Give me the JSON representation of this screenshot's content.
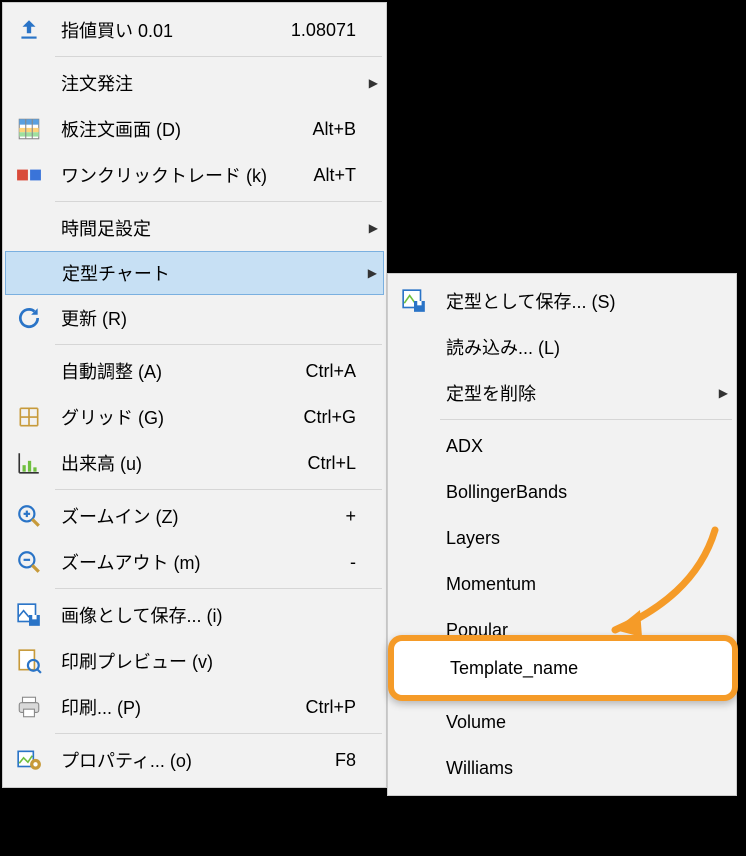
{
  "main_menu": {
    "limit_buy": {
      "label": "指値買い 0.01",
      "value": "1.08071"
    },
    "order": {
      "label": "注文発注"
    },
    "book": {
      "label": "板注文画面 (D)",
      "shortcut": "Alt+B"
    },
    "oneclick": {
      "label": "ワンクリックトレード (k)",
      "shortcut": "Alt+T"
    },
    "timeframe": {
      "label": "時間足設定"
    },
    "template": {
      "label": "定型チャート"
    },
    "refresh": {
      "label": "更新 (R)"
    },
    "autoscale": {
      "label": "自動調整 (A)",
      "shortcut": "Ctrl+A"
    },
    "grid": {
      "label": "グリッド (G)",
      "shortcut": "Ctrl+G"
    },
    "volume": {
      "label": "出来高 (u)",
      "shortcut": "Ctrl+L"
    },
    "zoomin": {
      "label": "ズームイン (Z)",
      "shortcut": "+"
    },
    "zoomout": {
      "label": "ズームアウト (m)",
      "shortcut": "-"
    },
    "saveimg": {
      "label": "画像として保存... (i)"
    },
    "preview": {
      "label": "印刷プレビュー (v)"
    },
    "print": {
      "label": "印刷... (P)",
      "shortcut": "Ctrl+P"
    },
    "props": {
      "label": "プロパティ... (o)",
      "shortcut": "F8"
    }
  },
  "sub_menu": {
    "save": {
      "label": "定型として保存... (S)"
    },
    "load": {
      "label": "読み込み... (L)"
    },
    "remove": {
      "label": "定型を削除"
    },
    "items": [
      "ADX",
      "BollingerBands",
      "Layers",
      "Momentum",
      "Popular",
      "Template_name",
      "Volume",
      "Williams"
    ]
  },
  "colors": {
    "highlight": "#f59b28",
    "hover_bg": "#c7e0f4"
  }
}
